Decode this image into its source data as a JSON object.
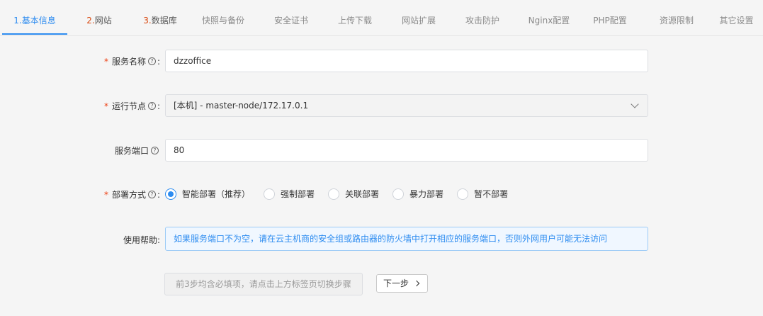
{
  "tabs": [
    {
      "num": "1.",
      "label": "基本信息",
      "active": true
    },
    {
      "num": "2.",
      "label": "网站"
    },
    {
      "num": "3.",
      "label": "数据库"
    },
    {
      "label": "快照与备份"
    },
    {
      "label": "安全证书"
    },
    {
      "label": "上传下载"
    },
    {
      "label": "网站扩展"
    },
    {
      "label": "攻击防护"
    },
    {
      "label": "Nginx配置"
    },
    {
      "label": "PHP配置"
    },
    {
      "label": "资源限制"
    },
    {
      "label": "其它设置"
    }
  ],
  "form": {
    "service_name": {
      "label": "服务名称",
      "value": "dzzoffice",
      "required": true
    },
    "run_node": {
      "label": "运行节点",
      "value": "[本机] - master-node/172.17.0.1",
      "required": true
    },
    "service_port": {
      "label": "服务端口",
      "value": "80"
    },
    "deploy_mode": {
      "label": "部署方式",
      "required": true,
      "options": [
        "智能部署（推荐）",
        "强制部署",
        "关联部署",
        "暴力部署",
        "暂不部署"
      ],
      "selected": "智能部署（推荐）"
    },
    "help": {
      "label": "使用帮助:",
      "text": "如果服务端口不为空，请在云主机商的安全组或路由器的防火墙中打开相应的服务端口，否则外网用户可能无法访问"
    }
  },
  "buttons": {
    "disabled_hint": "前3步均含必填项，请点击上方标签页切换步骤",
    "next_label": "下一步"
  },
  "colors": {
    "accent": "#2d8cf0",
    "required": "#ed4014",
    "step_number": "#d9480f"
  }
}
